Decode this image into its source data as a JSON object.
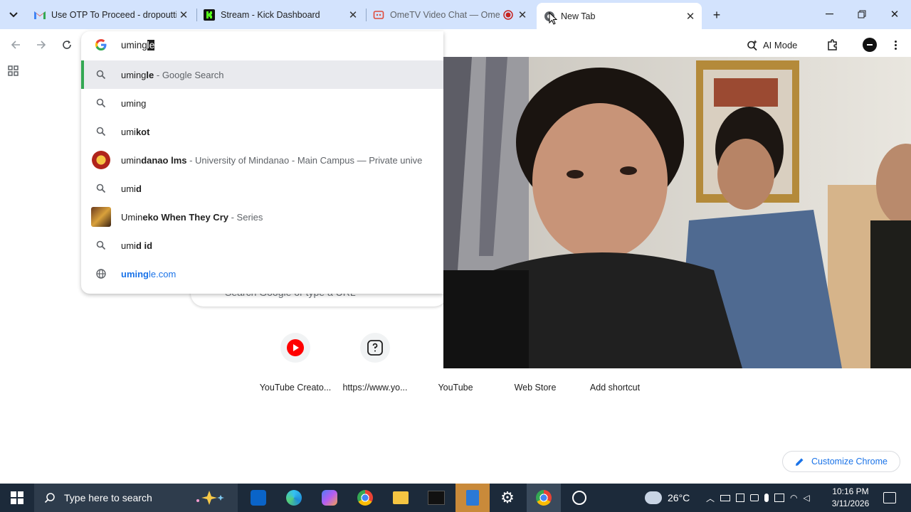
{
  "tabs": [
    {
      "title": "Use OTP To Proceed - dropoutti",
      "favicon": "gmail-icon"
    },
    {
      "title": "Stream - Kick Dashboard",
      "favicon": "kick-icon"
    },
    {
      "title": "OmeTV Video Chat — Ome",
      "favicon": "ometv-icon"
    },
    {
      "title": "New Tab",
      "favicon": "chrome-newtab-icon"
    }
  ],
  "omnibox": {
    "typed": "uming",
    "autocomplete": "le",
    "ai_mode_label": "AI Mode"
  },
  "suggestions": [
    {
      "icon": "search-icon",
      "match": "uming",
      "rest": "le",
      "desc": " - Google Search",
      "selected": true
    },
    {
      "icon": "search-icon",
      "match": "uming",
      "rest": "",
      "desc": ""
    },
    {
      "icon": "search-icon",
      "match": "umi",
      "rest": "kot",
      "desc": ""
    },
    {
      "icon": "umindanao-logo",
      "match": "umin",
      "rest": "danao lms",
      "desc": " - University of Mindanao - Main Campus — Private unive"
    },
    {
      "icon": "search-icon",
      "match": "umi",
      "rest": "d",
      "desc": ""
    },
    {
      "icon": "umineko-thumbnail",
      "match": "Umin",
      "rest": "eko When They Cry",
      "desc": " - Series"
    },
    {
      "icon": "search-icon",
      "match": "umi",
      "rest": "d id",
      "desc": ""
    },
    {
      "icon": "globe-icon",
      "match": "uming",
      "rest": "le.com",
      "desc": "",
      "link": true
    }
  ],
  "ntp": {
    "search_placeholder": "Search Google or type a URL",
    "shortcuts": [
      "YouTube Creato...",
      "https://www.yo...",
      "YouTube",
      "Web Store",
      "Add shortcut"
    ],
    "customize_label": "Customize Chrome"
  },
  "taskbar": {
    "search_placeholder": "Type here to search",
    "weather": "26°C",
    "time": "10:16 PM",
    "date": "3/11/2026"
  },
  "colors": {
    "tabstrip": "#d3e3fd",
    "accent_blue": "#1a73e8",
    "taskbar": "#1c2a3a",
    "selected_bar": "#34a853"
  }
}
